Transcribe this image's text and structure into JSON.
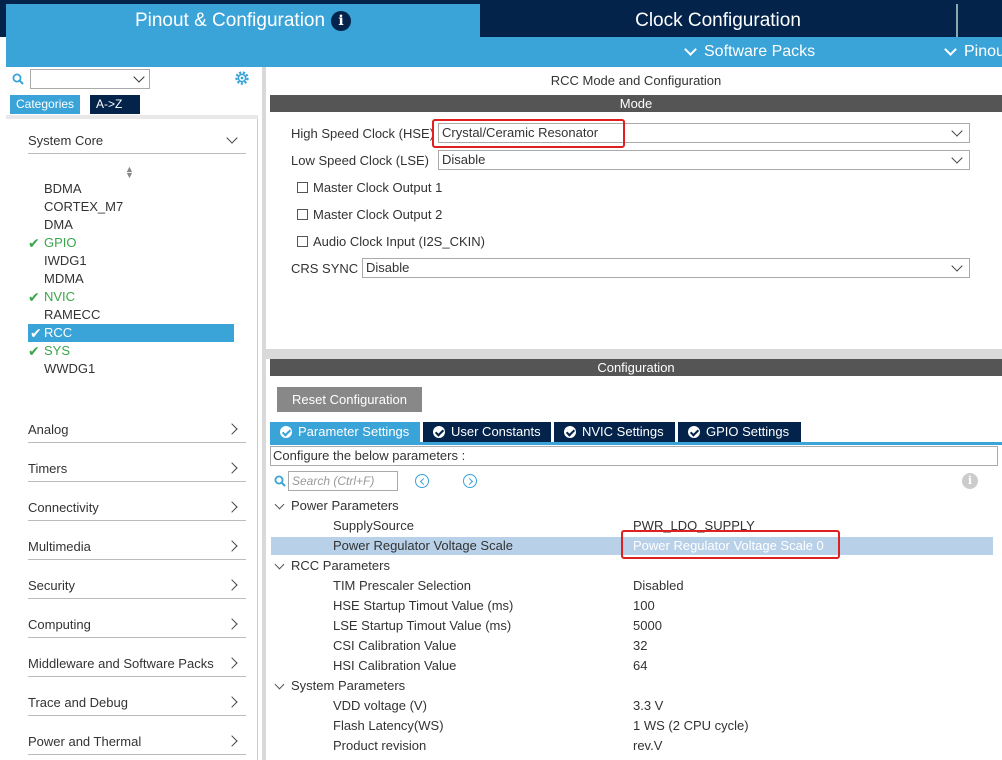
{
  "top_tabs": {
    "pinout": "Pinout & Configuration",
    "clock": "Clock Configuration"
  },
  "subbar": {
    "software_packs": "Software Packs",
    "pinout": "Pinout"
  },
  "left": {
    "tabs": {
      "categories": "Categories",
      "az": "A->Z"
    },
    "system_core": "System Core",
    "core_items": [
      {
        "label": "BDMA",
        "ok": false
      },
      {
        "label": "CORTEX_M7",
        "ok": false
      },
      {
        "label": "DMA",
        "ok": false
      },
      {
        "label": "GPIO",
        "ok": true
      },
      {
        "label": "IWDG1",
        "ok": false
      },
      {
        "label": "MDMA",
        "ok": false
      },
      {
        "label": "NVIC",
        "ok": true
      },
      {
        "label": "RAMECC",
        "ok": false
      },
      {
        "label": "RCC",
        "ok": true,
        "selected": true
      },
      {
        "label": "SYS",
        "ok": true
      },
      {
        "label": "WWDG1",
        "ok": false
      }
    ],
    "sections": [
      "Analog",
      "Timers",
      "Connectivity",
      "Multimedia",
      "Security",
      "Computing",
      "Middleware and Software Packs",
      "Trace and Debug",
      "Power and Thermal"
    ]
  },
  "right": {
    "title": "RCC Mode and Configuration",
    "mode_bar": "Mode",
    "hse_label": "High Speed Clock (HSE)",
    "hse_value": "Crystal/Ceramic Resonator",
    "lse_label": "Low Speed Clock (LSE)",
    "lse_value": "Disable",
    "mco1": "Master Clock Output 1",
    "mco2": "Master Clock Output 2",
    "audio": "Audio Clock Input (I2S_CKIN)",
    "crs_label": "CRS SYNC",
    "crs_value": "Disable",
    "config_bar": "Configuration",
    "reset": "Reset Configuration",
    "tabs": [
      "Parameter Settings",
      "User Constants",
      "NVIC Settings",
      "GPIO Settings"
    ],
    "configure_text": "Configure the below parameters :",
    "search_placeholder": "Search (Ctrl+F)",
    "groups": {
      "power": "Power Parameters",
      "rcc": "RCC Parameters",
      "system": "System Parameters"
    },
    "params": [
      {
        "name": "SupplySource",
        "value": "PWR_LDO_SUPPLY"
      },
      {
        "name": "Power Regulator Voltage Scale",
        "value": "Power Regulator Voltage Scale 0"
      },
      {
        "name": "TIM Prescaler Selection",
        "value": "Disabled"
      },
      {
        "name": "HSE Startup Timout Value (ms)",
        "value": "100"
      },
      {
        "name": "LSE Startup Timout Value (ms)",
        "value": "5000"
      },
      {
        "name": "CSI Calibration Value",
        "value": "32"
      },
      {
        "name": "HSI Calibration Value",
        "value": "64"
      },
      {
        "name": "VDD voltage (V)",
        "value": "3.3 V"
      },
      {
        "name": "Flash Latency(WS)",
        "value": "1 WS (2 CPU cycle)"
      },
      {
        "name": "Product revision",
        "value": "rev.V"
      }
    ]
  }
}
